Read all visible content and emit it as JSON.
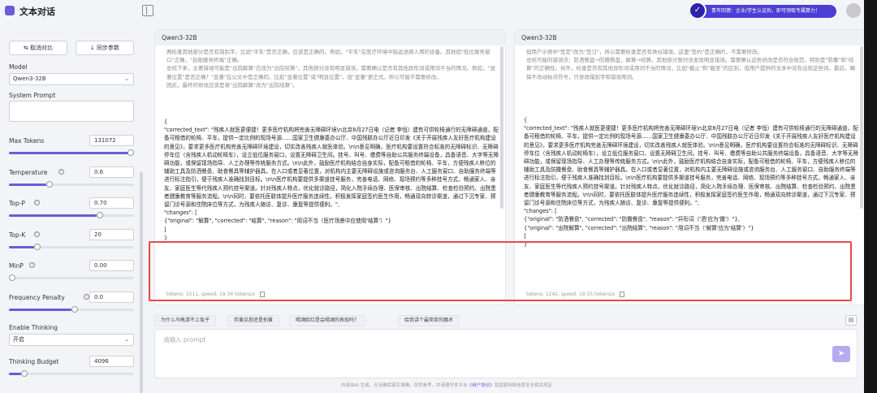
{
  "app": {
    "title": "文本对话",
    "promo": "青年回馈：企业/学生认证后，即可领取专属算力！"
  },
  "sidebar": {
    "cancel_label": "取消对比",
    "sync_label": "同步参数",
    "model_label": "Model",
    "model_value": "Qwen3-32B",
    "system_prompt_label": "System Prompt",
    "params": [
      {
        "label": "Max Tokens",
        "value": "131072",
        "fraction": 1.0
      },
      {
        "label": "Temperature",
        "value": "0.6",
        "fraction": 0.3
      },
      {
        "label": "Top-P",
        "value": "0.70",
        "fraction": 0.7
      },
      {
        "label": "Top-K",
        "value": "20",
        "fraction": 0.2
      },
      {
        "label": "MinP",
        "value": "0.00",
        "fraction": 0.0
      },
      {
        "label": "Frequency Penalty",
        "value": "0.0",
        "fraction": 0.5
      }
    ],
    "thinking_label": "Enable Thinking",
    "thinking_value": "开启",
    "budget_label": "Thinking Budget",
    "budget_value": "4096",
    "budget_fraction": 0.1
  },
  "left": {
    "model": "Qwen3-32B",
    "think": "两检查其他部分是否有错别字，比如\"平车\"是否正确，应该是正确的。例如，\"平车\"在医疗环境中指运送病人用的设备。其他如\"低位服务窗口\"正确，\"自助服务终端\"正确。\n总结下来，主要错误可能是\"出院解算\"应改为\"出院结算\"。其他部分没有明显错误。需要确认是否有其他异形词或用词不当的情况。例如，\"显著位置\"是否正确？\"显著\"在公文中是正确的，比如\"显著位置\"或\"明显位置\"，但\"显著\"更正式。所以可能不需要修改。\n因此，最终的修改应该是将\"出院解算\"改为\"出院结算\"。",
    "response": "{\n\"corrected_text\": \"残疾人就医更便捷！更多医疗机构将完善无障碍环境\\n北京8月27日电（记者 李恒）建有可供轮椅通行的无障碍通道，配备可租借的轮椅、平车，提供一定比例的现场号源……国家卫生健康委办公厅、中国残联办公厅近日印发《关于开展残疾人友好医疗机构建设的意见》，要求更多医疗机构完善无障碍环境建设，切实改善残疾人就医体验。\\n\\n意见明确，医疗机构要设置符合标准的无障碍标识、无障碍停车位（含残疾人机动轮椅车），设立低位服务窗口，设置无障碍卫生间。挂号、叫号、缴费等自助公共服务终端设备，具备语音、大字等无障碍功能，或保留现场指导、人工办理等传统服务方式。\\n\\n此外，鼓励医疗机构结合自身实际，配备可租借的轮椅、平车，方便残疾人移位的辅助工具及防洒餐盘、助食餐具等辅护器具。在入口或者显著位置，对机构内主要无障碍设施或咨询服务台、人工服务窗口、自助服务终端等进行标注指引，便于残疾人准确找到目标。\\n\\n医疗机构要提供多渠道挂号服务，完善电话、网络、现场预约等多种挂号方式，畅通家人、亲友、家庭医生等代残疾人预约挂号渠道。针对残疾人特点，优化就诊路径，简化入院手续办理、医保审核、出院结算、检查检验预约、出院患者健康教育等服务流程。\\n\\n同时，要依托医联体提升医疗服务连续性，积极发挥家庭签约医生作用，畅通双向转诊渠道，通过下沉专家、预留门诊号源和住院床位等方式，为残疾人随访、复诊、康复等提供便利。\",\n\"changes\": [\n{\"original\": \"解算\", \"corrected\": \"结算\", \"reason\": \"用词不当（医疗场景中应使用'结算'）\"}\n]\n}",
    "stats": "tokens: 1511, speed: 19.34 tokens/s"
  },
  "right": {
    "model": "Qwen3-32B",
    "think": "但用户示例中\"签定\"改为\"签订\"，所以需要检查是否有类似错误。这里\"签约\"是正确的，不需要修改。\n总结可能的错误点：防洒餐盘→防撒餐盘，解算→结算。其他部分暂时没发现明显错误。需要确认这些修改是否符合规范，特别是\"防撒\"和\"结算\"的正确性。另外，检查是否有其他异形词或用词不当的情况，比如\"截止\"和\"截至\"的区别，但用户提供的文本中没有出现这些词。最后，确保不改动标点符号，只修改错别字和错误用词。",
    "response": "{\n\"corrected_text\": \"残疾人就医更便捷！更多医疗机构将完善无障碍环境\\n北京8月27日电（记者 李恒）建有可供轮椅通行的无障碍通道，配备可租借的轮椅、平车，提供一定比例的现场号源……国家卫生健康委办公厅、中国残联办公厅近日印发《关于开展残疾人友好医疗机构建设的意见》，要求更多医疗机构完善无障碍环境建设，切实改善残疾人就医体验。\\n\\n意见明确，医疗机构要设置符合标准的无障碍标识、无障碍停车位（含残疾人机动轮椅车），设立低位服务窗口，设置无障碍卫生间。挂号、叫号、缴费等自助公共服务终端设备，具备语音、大字等无障碍功能，或保留现场指导、人工办理等传统服务方式。\\n\\n此外，鼓励医疗机构结合自身实际，配备可租借的轮椅、平车，方便残疾人移位的辅助工具及防撒餐盘、助食餐具等辅护器具。在入口或者显著位置，对机构内主要无障碍设施或咨询服务台、人工服务窗口、自助服务终端等进行标注指引，便于残疾人准确找到目标。\\n\\n医疗机构要提供多渠道挂号服务，完善电话、网络、现场预约等多种挂号方式，畅通家人、亲友、家庭医生等代残疾人预约挂号渠道。针对残疾人特点，优化就诊路径，简化入院手续办理、医保审核、出院结算、检查检验预约、出院患者健康教育等服务流程。\\n\\n同时，要依托医联体提升医疗服务连续性，积极发挥家庭签约医生作用，畅通双向转诊渠道，通过下沉专家、预留门诊号源和住院床位等方式，为残疾人随访、复诊、康复等提供便利。\",\n\"changes\": [\n{\"original\": \"防洒餐盘\", \"corrected\": \"防撒餐盘\", \"reason\": \"异形词（'洒'应为'撒'）\"},\n{\"original\": \"出院解算\", \"corrected\": \"出院结算\", \"reason\": \"用词不当（'解算'应为'结算'）\"}\n]\n}",
    "stats": "tokens: 1242, speed: 19.55 tokens/s"
  },
  "suggestions": [
    "为什么乌龟游不上兔子",
    "拌黄瓜抱还是拍黄",
    "喝酒脸红是会喝酒的表现吗？",
    "给我讲个最简单的魔术"
  ],
  "input": {
    "placeholder": "请输入 prompt"
  },
  "footer": {
    "text": "内容由AI 生成，无法确保真实准确，仅供参考，并请遵守本平台",
    "link": "《用户协议》",
    "text2": "及国家网络信息安全相关规定"
  }
}
